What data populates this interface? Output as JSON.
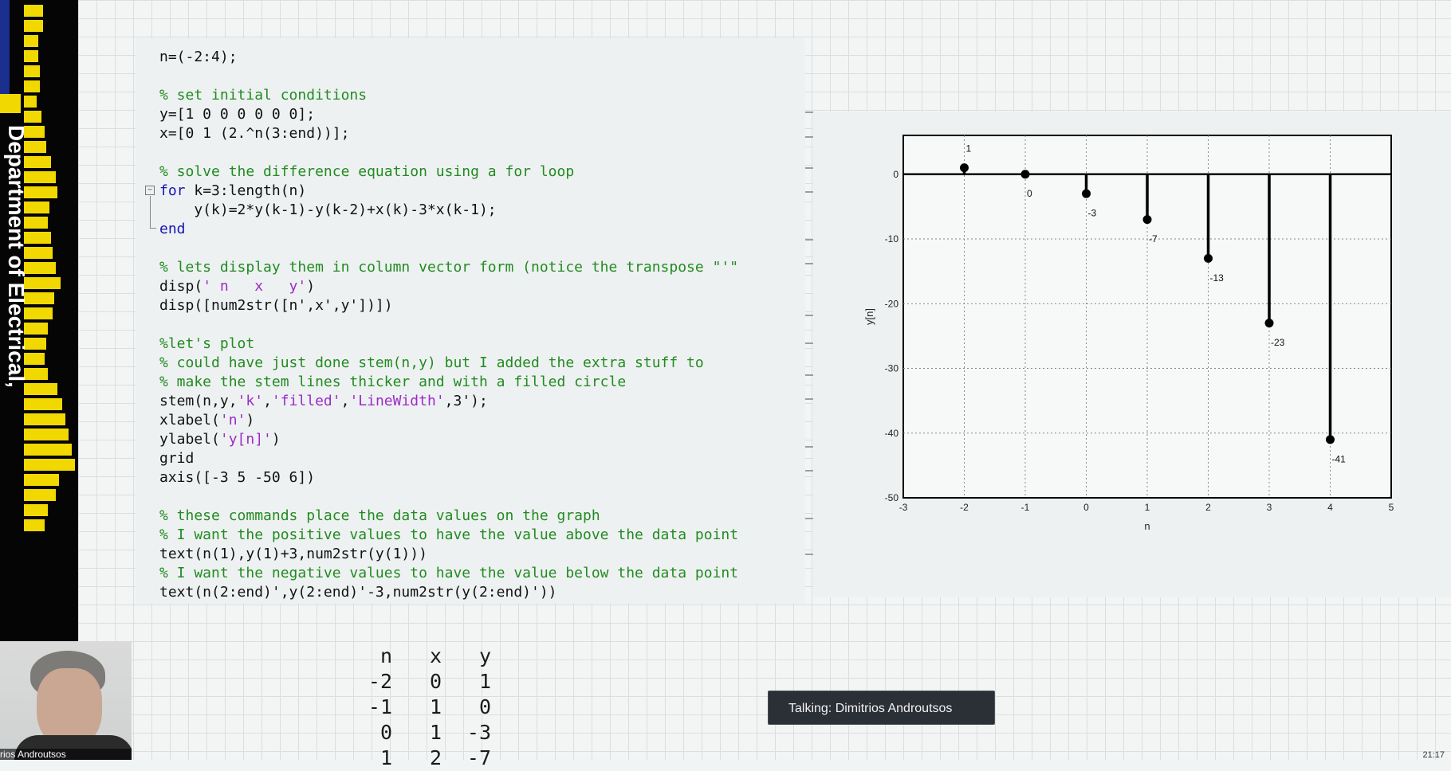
{
  "sidebar": {
    "department_label": "Department of Electrical,",
    "colors": {
      "background": "#050505",
      "accent": "#f1d800",
      "blue": "#1b2f8f"
    }
  },
  "webcam": {
    "name": "rios Androutsos"
  },
  "code": {
    "lines": [
      [
        {
          "t": "n=(-2:4);",
          "c": "plain"
        }
      ],
      [],
      [
        {
          "t": "% set initial conditions",
          "c": "com"
        }
      ],
      [
        {
          "t": "y=[1 0 0 0 0 0 0];",
          "c": "plain"
        }
      ],
      [
        {
          "t": "x=[0 1 (2.^n(3:end))];",
          "c": "plain"
        }
      ],
      [],
      [
        {
          "t": "% solve the difference equation using a for loop",
          "c": "com"
        }
      ],
      [
        {
          "t": "for",
          "c": "kw"
        },
        {
          "t": " k=3:length(n)",
          "c": "plain"
        }
      ],
      [
        {
          "t": "    y(k)=2*y(k-1)-y(k-2)+x(k)-3*x(k-1);",
          "c": "plain"
        }
      ],
      [
        {
          "t": "end",
          "c": "kw"
        }
      ],
      [],
      [
        {
          "t": "% lets display them in column vector form (notice the transpose \"'\"",
          "c": "com"
        }
      ],
      [
        {
          "t": "disp(",
          "c": "plain"
        },
        {
          "t": "' n   x   y'",
          "c": "str"
        },
        {
          "t": ")",
          "c": "plain"
        }
      ],
      [
        {
          "t": "disp([num2str([n',x',y'])])",
          "c": "plain"
        }
      ],
      [],
      [
        {
          "t": "%let's plot",
          "c": "com"
        }
      ],
      [
        {
          "t": "% could have just done stem(n,y) but I added the extra stuff to",
          "c": "com"
        }
      ],
      [
        {
          "t": "% make the stem lines thicker and with a filled circle",
          "c": "com"
        }
      ],
      [
        {
          "t": "stem(n,y,",
          "c": "plain"
        },
        {
          "t": "'k'",
          "c": "str"
        },
        {
          "t": ",",
          "c": "plain"
        },
        {
          "t": "'filled'",
          "c": "str"
        },
        {
          "t": ",",
          "c": "plain"
        },
        {
          "t": "'LineWidth'",
          "c": "str"
        },
        {
          "t": ",3');",
          "c": "plain"
        }
      ],
      [
        {
          "t": "xlabel(",
          "c": "plain"
        },
        {
          "t": "'n'",
          "c": "str"
        },
        {
          "t": ")",
          "c": "plain"
        }
      ],
      [
        {
          "t": "ylabel(",
          "c": "plain"
        },
        {
          "t": "'y[n]'",
          "c": "str"
        },
        {
          "t": ")",
          "c": "plain"
        }
      ],
      [
        {
          "t": "grid",
          "c": "plain"
        }
      ],
      [
        {
          "t": "axis([-3 5 -50 6])",
          "c": "plain"
        }
      ],
      [],
      [
        {
          "t": "% these commands place the data values on the graph",
          "c": "com"
        }
      ],
      [
        {
          "t": "% I want the positive values to have the value above the data point",
          "c": "com"
        }
      ],
      [
        {
          "t": "text(n(1),y(1)+3,num2str(y(1)))",
          "c": "plain"
        }
      ],
      [
        {
          "t": "% I want the negative values to have the value below the data point",
          "c": "com"
        }
      ],
      [
        {
          "t": "text(n(2:end)',y(2:end)'-3,num2str(y(2:end)'))",
          "c": "plain"
        }
      ]
    ],
    "colors": {
      "comment": "#228b22",
      "keyword": "#1414b4",
      "string": "#9b2cc9"
    }
  },
  "chart_data": {
    "type": "stem",
    "x": [
      -2,
      -1,
      0,
      1,
      2,
      3,
      4
    ],
    "values": [
      1,
      0,
      -3,
      -7,
      -13,
      -23,
      -41
    ],
    "data_labels": [
      "1",
      "0",
      "-3",
      "-7",
      "-13",
      "-23",
      "-41"
    ],
    "xlabel": "n",
    "ylabel": "y[n]",
    "xlim": [
      -3,
      5
    ],
    "ylim": [
      -50,
      6
    ],
    "x_ticks": [
      "-3",
      "-2",
      "-1",
      "0",
      "1",
      "2",
      "3",
      "4",
      "5"
    ],
    "y_ticks": [
      "0",
      "-10",
      "-20",
      "-30",
      "-40",
      "-50"
    ],
    "y_tick_values": [
      0,
      -10,
      -20,
      -30,
      -40,
      -50
    ],
    "grid": true,
    "color": "#000000"
  },
  "output": {
    "header": [
      "n",
      "x",
      "y"
    ],
    "rows": [
      [
        "-2",
        "0",
        "1"
      ],
      [
        "-1",
        "1",
        "0"
      ],
      [
        "0",
        "1",
        "-3"
      ],
      [
        "1",
        "2",
        "-7"
      ]
    ]
  },
  "toast": {
    "text": "Talking: Dimitrios Androutsos"
  },
  "clock": {
    "text": "21:17"
  }
}
